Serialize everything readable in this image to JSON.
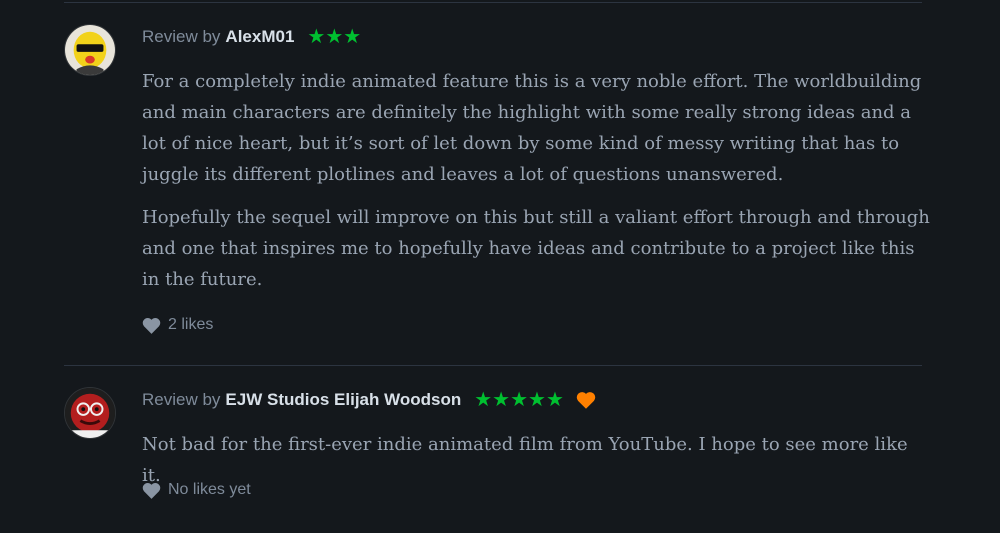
{
  "colors": {
    "background": "#14181c",
    "star_green": "#00c030",
    "liked_orange": "#ff8000",
    "text_body": "#9aa5b3",
    "text_name": "#d8e0e8"
  },
  "reviews": [
    {
      "by_prefix": "Review by",
      "author": "AlexM01",
      "rating": "★★★",
      "liked": false,
      "avatar_icon": "yellow-cartoon-character-avatar",
      "paragraphs": [
        "For a completely indie animated feature this is a very noble effort. The worldbuilding and main characters are definitely the highlight with some really strong ideas and a lot of nice heart, but it’s sort of let down by some kind of messy writing that has to juggle its different plotlines and leaves a lot of questions unanswered.",
        "Hopefully the sequel will improve on this but still a valiant effort through and through and one that inspires me to hopefully have ideas and contribute to a project like this in the future."
      ],
      "likes_label": "2 likes",
      "like_icon": "heart-icon"
    },
    {
      "by_prefix": "Review by",
      "author": "EJW Studios Elijah Woodson",
      "rating": "★★★★★",
      "liked": true,
      "liked_icon": "orange-heart-icon",
      "avatar_icon": "red-cartoon-character-avatar",
      "paragraphs": [
        "Not bad for the first-ever indie animated film from YouTube. I hope to see more like it."
      ],
      "likes_label": "No likes yet",
      "like_icon": "heart-icon"
    }
  ]
}
